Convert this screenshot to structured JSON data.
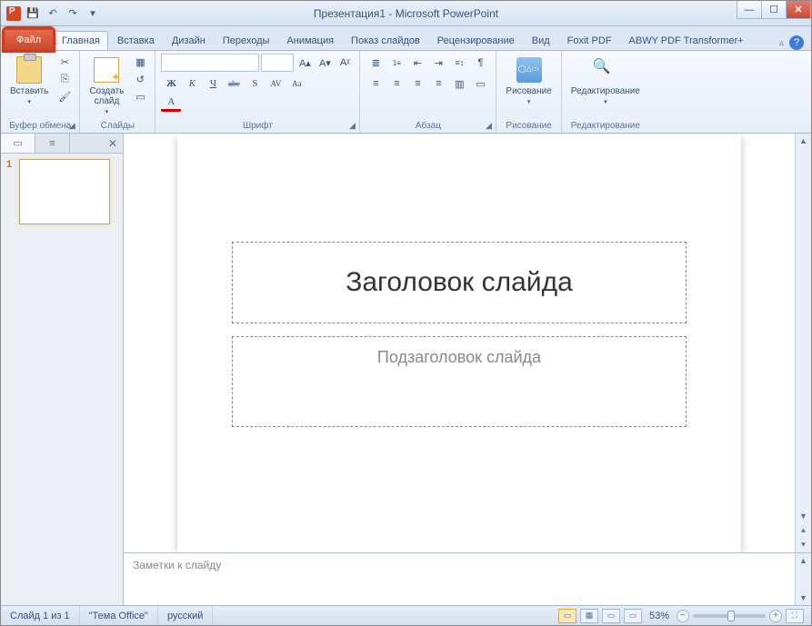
{
  "title": "Презентация1 - Microsoft PowerPoint",
  "qat": {
    "save": "💾",
    "undo": "↶",
    "redo": "↷",
    "more": "▾"
  },
  "winbtns": {
    "min": "—",
    "max": "☐",
    "close": "✕"
  },
  "tabs": {
    "file": "Файл",
    "items": [
      "Главная",
      "Вставка",
      "Дизайн",
      "Переходы",
      "Анимация",
      "Показ слайдов",
      "Рецензирование",
      "Вид",
      "Foxit PDF",
      "ABWY PDF Transformer+"
    ],
    "active": 0,
    "minimize": "▵",
    "help": "?"
  },
  "ribbon": {
    "clipboard": {
      "label": "Буфер обмена",
      "paste": "Вставить",
      "cut": "✂",
      "copy": "⎘",
      "painter": "🖌"
    },
    "slides": {
      "label": "Слайды",
      "new": "Создать\nслайд",
      "layout": "▦",
      "reset": "↺",
      "section": "▭"
    },
    "font": {
      "label": "Шрифт",
      "name_placeholder": " ",
      "size_placeholder": " ",
      "grow": "A▴",
      "shrink": "A▾",
      "clear": "Aᵡ",
      "bold": "Ж",
      "italic": "К",
      "underline": "Ч",
      "strike": "abc",
      "shadow": "S",
      "spacing": "AV",
      "case": "Aa",
      "color": "A"
    },
    "paragraph": {
      "label": "Абзац",
      "bullets": "≣",
      "numbers": "1≡",
      "indentL": "⇤",
      "indentR": "⇥",
      "linesp": "≡↕",
      "dir": "¶",
      "alignL": "≡",
      "alignC": "≡",
      "alignR": "≡",
      "justify": "≡",
      "cols": "▥",
      "convert": "▭"
    },
    "drawing": {
      "label": "Рисование",
      "btn": "Рисование"
    },
    "editing": {
      "label": "Редактирование",
      "btn": "Редактирование"
    }
  },
  "panetabs": {
    "slides_icon": "▭",
    "outline_icon": "≡",
    "close": "✕"
  },
  "thumb": {
    "num": "1"
  },
  "slide": {
    "title": "Заголовок слайда",
    "subtitle": "Подзаголовок слайда"
  },
  "notes": {
    "placeholder": "Заметки к слайду"
  },
  "status": {
    "slide": "Слайд 1 из 1",
    "theme": "\"Тема Office\"",
    "lang": "русский",
    "views": {
      "normal": "▭",
      "sorter": "▦",
      "reading": "▭",
      "show": "▭"
    },
    "zoom": "53%",
    "minus": "−",
    "plus": "+",
    "fit": "⛶"
  },
  "scroll": {
    "up": "▲",
    "down": "▼",
    "prev": "⯅",
    "next": "⯆"
  }
}
